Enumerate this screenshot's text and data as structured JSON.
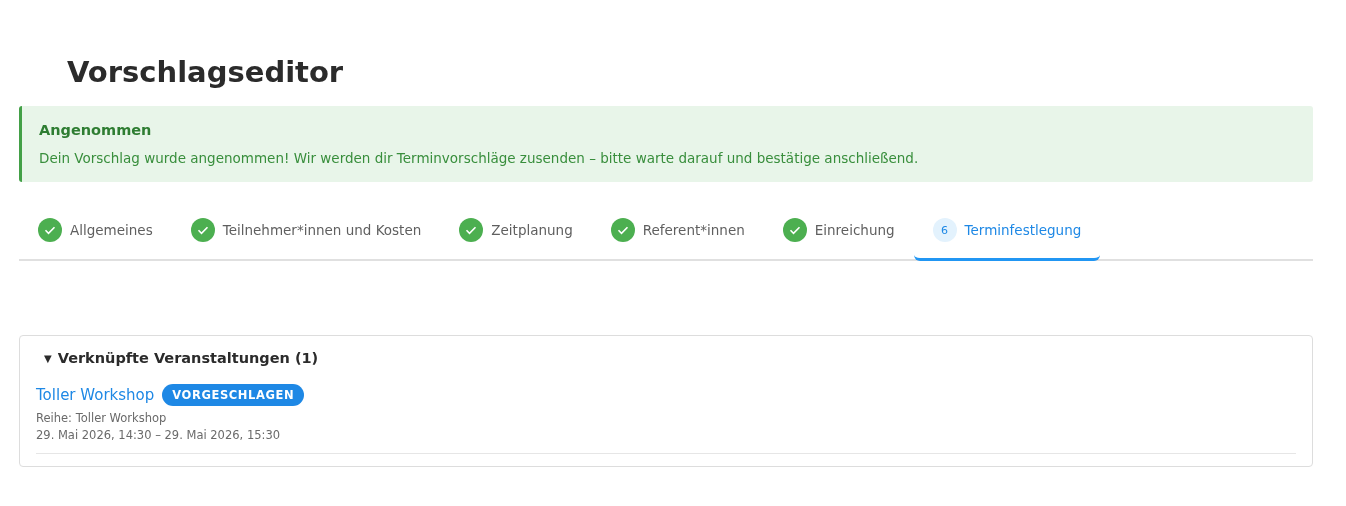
{
  "title": "Vorschlagseditor",
  "alert": {
    "heading": "Angenommen",
    "message": "Dein Vorschlag wurde angenommen! Wir werden dir Terminvorschläge zusenden – bitte warte darauf und bestätige anschließend."
  },
  "tabs": [
    {
      "label": "Allgemeines",
      "kind": "done",
      "selected": false
    },
    {
      "label": "Teilnehmer*innen und Kosten",
      "kind": "done",
      "selected": false
    },
    {
      "label": "Zeitplanung",
      "kind": "done",
      "selected": false
    },
    {
      "label": "Referent*innen",
      "kind": "done",
      "selected": false
    },
    {
      "label": "Einreichung",
      "kind": "done",
      "selected": false
    },
    {
      "label": "Terminfestlegung",
      "kind": "step",
      "number": "6",
      "selected": true
    }
  ],
  "linked_events": {
    "toggle": "▼",
    "heading": "Verknüpfte Veranstaltungen (1)",
    "events": [
      {
        "name": "Toller Workshop",
        "status": "VORGESCHLAGEN",
        "series": "Reihe: Toller Workshop",
        "time": "29. Mai 2026, 14:30 – 29. Mai 2026, 15:30"
      }
    ]
  }
}
